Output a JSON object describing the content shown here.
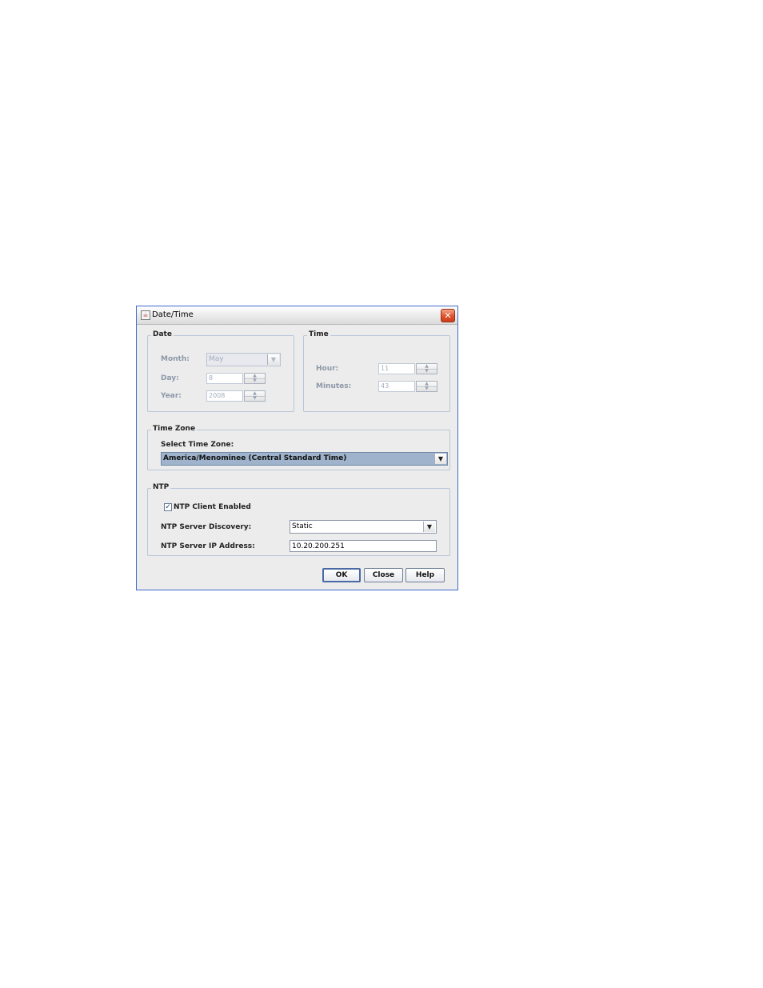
{
  "window": {
    "title": "Date/Time",
    "close_glyph": "✕",
    "icon": "java-cup-icon"
  },
  "date": {
    "legend": "Date",
    "month_label": "Month:",
    "month_value": "May",
    "day_label": "Day:",
    "day_value": "8",
    "year_label": "Year:",
    "year_value": "2008"
  },
  "time": {
    "legend": "Time",
    "hour_label": "Hour:",
    "hour_value": "11",
    "minutes_label": "Minutes:",
    "minutes_value": "43"
  },
  "timezone": {
    "legend": "Time Zone",
    "select_label": "Select Time Zone:",
    "selected": "America/Menominee (Central Standard Time)"
  },
  "ntp": {
    "legend": "NTP",
    "client_enabled_label": "NTP Client Enabled",
    "client_enabled_checked": true,
    "check_glyph": "✓",
    "discovery_label": "NTP Server Discovery:",
    "discovery_value": "Static",
    "ip_label": "NTP Server IP Address:",
    "ip_value": "10.20.200.251"
  },
  "buttons": {
    "ok": "OK",
    "close": "Close",
    "help": "Help"
  },
  "glyphs": {
    "combo_arrow": "▼",
    "spin_up": "▲",
    "spin_down": "▼"
  },
  "colors": {
    "window_border": "#3f6cc8",
    "close_red": "#e0522a",
    "selection": "#9fb4cc",
    "disabled_text": "#8c98a8"
  }
}
